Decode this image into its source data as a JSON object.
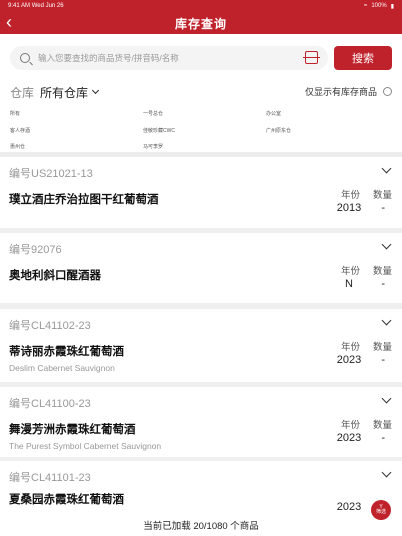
{
  "status_bar": {
    "time": "9:41 AM",
    "date": "Wed Jun 26",
    "battery": "100%"
  },
  "nav": {
    "title": "库存查询"
  },
  "search": {
    "placeholder": "输入您要查找的商品货号/拼音码/名称",
    "button_label": "搜索"
  },
  "warehouse": {
    "label": "仓库",
    "selected": "所有仓库",
    "stock_only_label": "仅显示有库存商品",
    "options": [
      "所有",
      "一号总仓",
      "办公室",
      "客人存酒",
      "佳敏珍藏CWC",
      "广州原东仓",
      "惠州仓",
      "马可李罗"
    ]
  },
  "products": [
    {
      "code": "编号US21021-13",
      "name": "璞立酒庄乔治拉图干红葡萄酒",
      "name_en": "",
      "year_label": "年份",
      "year": "2013",
      "qty_label": "数量",
      "qty": "-"
    },
    {
      "code": "编号92076",
      "name": "奥地利斜口醒酒器",
      "name_en": "",
      "year_label": "年份",
      "year": "N",
      "qty_label": "数量",
      "qty": "-"
    },
    {
      "code": "编号CL41102-23",
      "name": "蒂诗丽赤霞珠红葡萄酒",
      "name_en": "Deslim Cabernet Sauvignon",
      "year_label": "年份",
      "year": "2023",
      "qty_label": "数量",
      "qty": "-"
    },
    {
      "code": "编号CL41100-23",
      "name": "舞漫芳洲赤霞珠红葡萄酒",
      "name_en": "The Purest Symbol Cabernet Sauvignon",
      "year_label": "年份",
      "year": "2023",
      "qty_label": "数量",
      "qty": "-"
    },
    {
      "code": "编号CL41101-23",
      "name": "夏桑园赤霞珠红葡萄酒",
      "name_en": "",
      "year_label": "年份",
      "year": "2023",
      "qty_label": "",
      "qty": ""
    }
  ],
  "footer": {
    "loaded_text": "当前已加载 20/1080 个商品"
  },
  "fab": {
    "label": "Y",
    "sublabel": "筛选"
  },
  "colors": {
    "primary": "#c0222c",
    "background": "#efefef"
  }
}
